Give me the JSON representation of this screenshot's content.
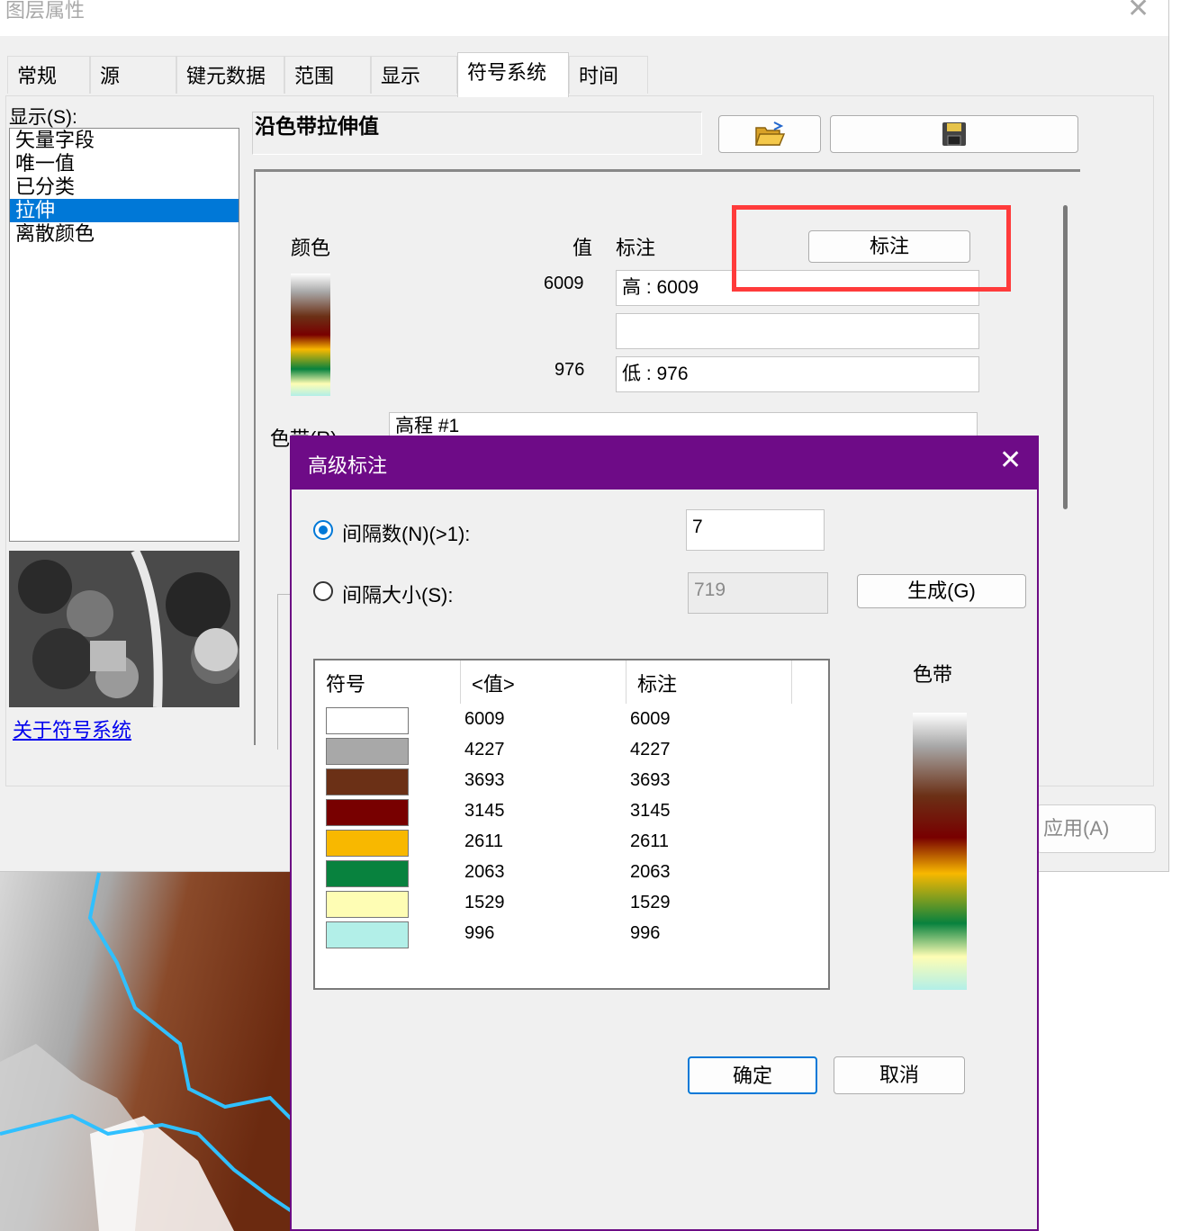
{
  "parent_dialog": {
    "title": "图层属性",
    "close_glyph": "✕",
    "tabs": [
      {
        "label": "常规"
      },
      {
        "label": "源"
      },
      {
        "label": "键元数据"
      },
      {
        "label": "范围"
      },
      {
        "label": "显示"
      },
      {
        "label": "符号系统",
        "active": true
      },
      {
        "label": "时间"
      }
    ],
    "show_label": "显示(S):",
    "renderers": [
      "矢量字段",
      "唯一值",
      "已分类",
      "拉伸",
      "离散颜色"
    ],
    "selected_renderer": "拉伸",
    "about_link": "关于符号系统",
    "renderer_title": "沿色带拉伸值",
    "open_icon": "folder-open-icon",
    "save_icon": "floppy-save-icon",
    "color_header": "颜色",
    "value_header": "值",
    "label_header": "标注",
    "label_button": "标注",
    "high_value": "6009",
    "low_value": "976",
    "high_label": "高 : 6009",
    "mid_label": "",
    "low_label": "低 : 976",
    "color_ramp_label": "色带(R)",
    "color_ramp_value": "高程 #1",
    "apply_button": "应用(A)",
    "highlight_color": "#ff3b3b"
  },
  "modal": {
    "title": "高级标注",
    "close_glyph": "✕",
    "interval_count_label": "间隔数(N)(>1):",
    "interval_count_value": "7",
    "interval_size_label": "间隔大小(S):",
    "interval_size_value": "719",
    "generate_button": "生成(G)",
    "table_headers": [
      "符号",
      "<值>",
      "标注"
    ],
    "rows": [
      {
        "color": "#ffffff",
        "value": "6009",
        "label": "6009"
      },
      {
        "color": "#a8a8a8",
        "value": "4227",
        "label": "4227"
      },
      {
        "color": "#6b3016",
        "value": "3693",
        "label": "3693"
      },
      {
        "color": "#780000",
        "value": "3145",
        "label": "3145"
      },
      {
        "color": "#f8b800",
        "value": "2611",
        "label": "2611"
      },
      {
        "color": "#08823e",
        "value": "2063",
        "label": "2063"
      },
      {
        "color": "#fefdb4",
        "value": "1529",
        "label": "1529"
      },
      {
        "color": "#b2efe8",
        "value": "996",
        "label": "996"
      }
    ],
    "color_ramp_label": "色带",
    "ok_button": "确定",
    "cancel_button": "取消",
    "title_bar_color": "#6e0b87"
  }
}
